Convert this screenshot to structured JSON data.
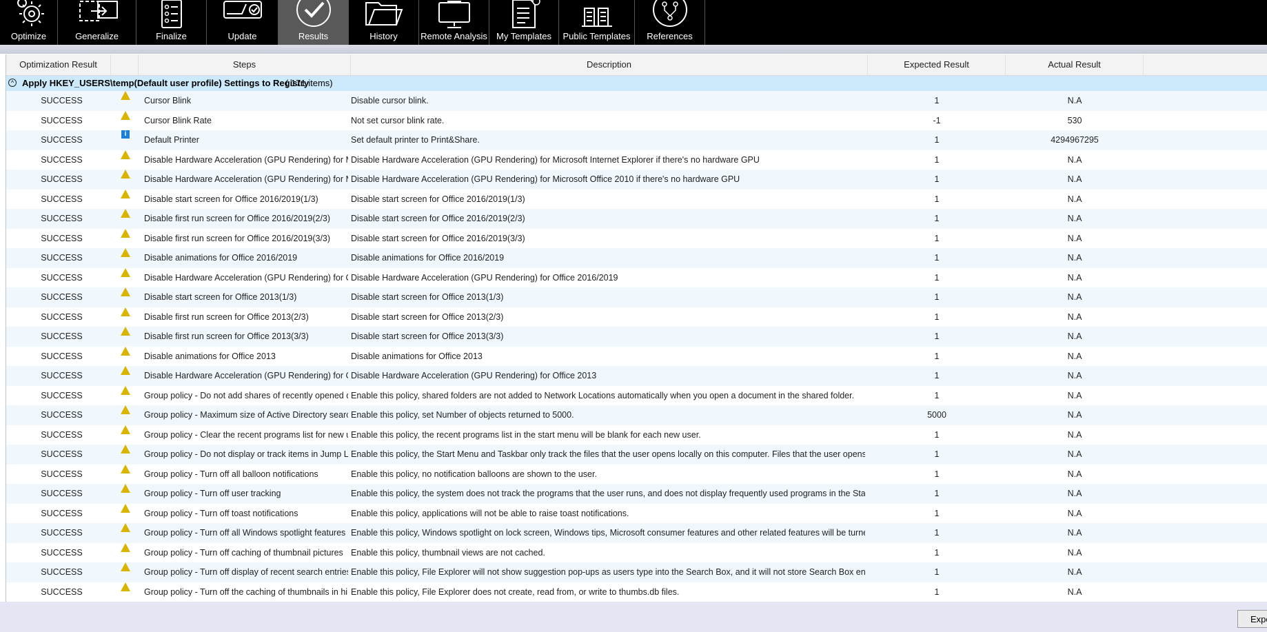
{
  "toolbar": {
    "items": [
      {
        "label": "Optimize",
        "icon": "gears-icon"
      },
      {
        "label": "Generalize",
        "icon": "generalize-icon"
      },
      {
        "label": "Finalize",
        "icon": "checklist-icon"
      },
      {
        "label": "Update",
        "icon": "update-icon"
      },
      {
        "label": "Results",
        "icon": "checkmark-circle-icon"
      },
      {
        "label": "History",
        "icon": "folder-icon"
      },
      {
        "label": "Remote Analysis",
        "icon": "monitor-icon"
      },
      {
        "label": "My Templates",
        "icon": "document-icon"
      },
      {
        "label": "Public Templates",
        "icon": "public-templates-icon"
      },
      {
        "label": "References",
        "icon": "references-icon"
      }
    ],
    "active": "Results"
  },
  "columns": {
    "result": "Optimization Result",
    "steps": "Steps",
    "description": "Description",
    "expected": "Expected Result",
    "actual": "Actual Result"
  },
  "group": {
    "title": "Apply HKEY_USERS\\temp(Default user profile) Settings to Registry",
    "count": "( 171  items)"
  },
  "rows": [
    {
      "result": "SUCCESS",
      "icon": "warning",
      "step": "Cursor Blink",
      "description": "Disable cursor blink.",
      "expected": "1",
      "actual": "N.A"
    },
    {
      "result": "SUCCESS",
      "icon": "warning",
      "step": "Cursor Blink Rate",
      "description": "Not set cursor blink rate.",
      "expected": "-1",
      "actual": "530"
    },
    {
      "result": "SUCCESS",
      "icon": "info",
      "step": "Default Printer",
      "description": "Set default printer to Print&Share.",
      "expected": "1",
      "actual": "4294967295"
    },
    {
      "result": "SUCCESS",
      "icon": "warning",
      "step": "Disable Hardware Acceleration (GPU Rendering) for Mi",
      "description": "Disable Hardware Acceleration (GPU Rendering) for Microsoft Internet Explorer if there's no hardware GPU",
      "expected": "1",
      "actual": "N.A"
    },
    {
      "result": "SUCCESS",
      "icon": "warning",
      "step": "Disable Hardware Acceleration (GPU Rendering) for Mi",
      "description": "Disable Hardware Acceleration (GPU Rendering) for Microsoft Office 2010 if there's no hardware GPU",
      "expected": "1",
      "actual": "N.A"
    },
    {
      "result": "SUCCESS",
      "icon": "warning",
      "step": "Disable start screen for Office 2016/2019(1/3)",
      "description": "Disable start screen for Office 2016/2019(1/3)",
      "expected": "1",
      "actual": "N.A"
    },
    {
      "result": "SUCCESS",
      "icon": "warning",
      "step": "Disable first run screen for Office 2016/2019(2/3)",
      "description": "Disable start screen for Office 2016/2019(2/3)",
      "expected": "1",
      "actual": "N.A"
    },
    {
      "result": "SUCCESS",
      "icon": "warning",
      "step": "Disable first run screen for Office 2016/2019(3/3)",
      "description": "Disable start screen for Office 2016/2019(3/3)",
      "expected": "1",
      "actual": "N.A"
    },
    {
      "result": "SUCCESS",
      "icon": "warning",
      "step": "Disable animations for Office 2016/2019",
      "description": "Disable animations for Office 2016/2019",
      "expected": "1",
      "actual": "N.A"
    },
    {
      "result": "SUCCESS",
      "icon": "warning",
      "step": "Disable Hardware Acceleration (GPU Rendering) for Of",
      "description": "Disable Hardware Acceleration (GPU Rendering) for Office 2016/2019",
      "expected": "1",
      "actual": "N.A"
    },
    {
      "result": "SUCCESS",
      "icon": "warning",
      "step": "Disable start screen for Office 2013(1/3)",
      "description": "Disable start screen for Office 2013(1/3)",
      "expected": "1",
      "actual": "N.A"
    },
    {
      "result": "SUCCESS",
      "icon": "warning",
      "step": "Disable first run screen for Office 2013(2/3)",
      "description": "Disable start screen for Office 2013(2/3)",
      "expected": "1",
      "actual": "N.A"
    },
    {
      "result": "SUCCESS",
      "icon": "warning",
      "step": "Disable first run screen for Office 2013(3/3)",
      "description": "Disable start screen for Office 2013(3/3)",
      "expected": "1",
      "actual": "N.A"
    },
    {
      "result": "SUCCESS",
      "icon": "warning",
      "step": "Disable animations for Office 2013",
      "description": "Disable animations for Office 2013",
      "expected": "1",
      "actual": "N.A"
    },
    {
      "result": "SUCCESS",
      "icon": "warning",
      "step": "Disable Hardware Acceleration (GPU Rendering) for Of",
      "description": "Disable Hardware Acceleration (GPU Rendering) for Office 2013",
      "expected": "1",
      "actual": "N.A"
    },
    {
      "result": "SUCCESS",
      "icon": "warning",
      "step": "Group policy - Do not add shares of recently opened d",
      "description": "Enable this policy, shared folders are not added to Network Locations automatically when you open a document in the shared folder.",
      "expected": "1",
      "actual": "N.A"
    },
    {
      "result": "SUCCESS",
      "icon": "warning",
      "step": "Group policy - Maximum size of Active Directory searc",
      "description": "Enable this policy, set Number of objects returned to 5000.",
      "expected": "5000",
      "actual": "N.A"
    },
    {
      "result": "SUCCESS",
      "icon": "warning",
      "step": "Group policy - Clear the recent programs list for new u",
      "description": "Enable this policy, the recent programs list in the start menu will be blank for each new user.",
      "expected": "1",
      "actual": "N.A"
    },
    {
      "result": "SUCCESS",
      "icon": "warning",
      "step": "Group policy - Do not display or track items in Jump Li",
      "description": "Enable this policy, the Start Menu and Taskbar only track the files that the user opens locally on this computer. Files that the user opens over",
      "expected": "1",
      "actual": "N.A"
    },
    {
      "result": "SUCCESS",
      "icon": "warning",
      "step": "Group policy - Turn off all balloon notifications",
      "description": "Enable this policy, no notification balloons are shown to the user.",
      "expected": "1",
      "actual": "N.A"
    },
    {
      "result": "SUCCESS",
      "icon": "warning",
      "step": "Group policy - Turn off user tracking",
      "description": "Enable this policy, the system does not track the programs that the user runs, and does not display frequently used programs in the Start Me",
      "expected": "1",
      "actual": "N.A"
    },
    {
      "result": "SUCCESS",
      "icon": "warning",
      "step": "Group policy - Turn off toast notifications",
      "description": "Enable this policy, applications will not be able to raise toast notifications.",
      "expected": "1",
      "actual": "N.A"
    },
    {
      "result": "SUCCESS",
      "icon": "warning",
      "step": "Group policy - Turn off all Windows spotlight features",
      "description": "Enable this policy, Windows spotlight on lock screen, Windows tips, Microsoft consumer features and other related features will be turned o",
      "expected": "1",
      "actual": "N.A"
    },
    {
      "result": "SUCCESS",
      "icon": "warning",
      "step": "Group policy - Turn off caching of thumbnail pictures",
      "description": "Enable this policy, thumbnail views are not cached.",
      "expected": "1",
      "actual": "N.A"
    },
    {
      "result": "SUCCESS",
      "icon": "warning",
      "step": "Group policy - Turn off display of recent search entries",
      "description": "Enable this policy, File Explorer will not show suggestion pop-ups as users type into the Search Box, and it will not store Search Box entries i",
      "expected": "1",
      "actual": "N.A"
    },
    {
      "result": "SUCCESS",
      "icon": "warning",
      "step": "Group policy - Turn off the caching of thumbnails in hi",
      "description": "Enable this policy, File Explorer does not create, read from, or write to thumbs.db files.",
      "expected": "1",
      "actual": "N.A"
    }
  ],
  "footer": {
    "export_label": "Expo"
  },
  "colors": {
    "toolbar_bg": "#000000",
    "active_tab": "#595959",
    "group_bg": "#cdeafc",
    "alt_row": "#f0f7fd",
    "warning": "#d9b400",
    "info": "#1e7fd6"
  }
}
